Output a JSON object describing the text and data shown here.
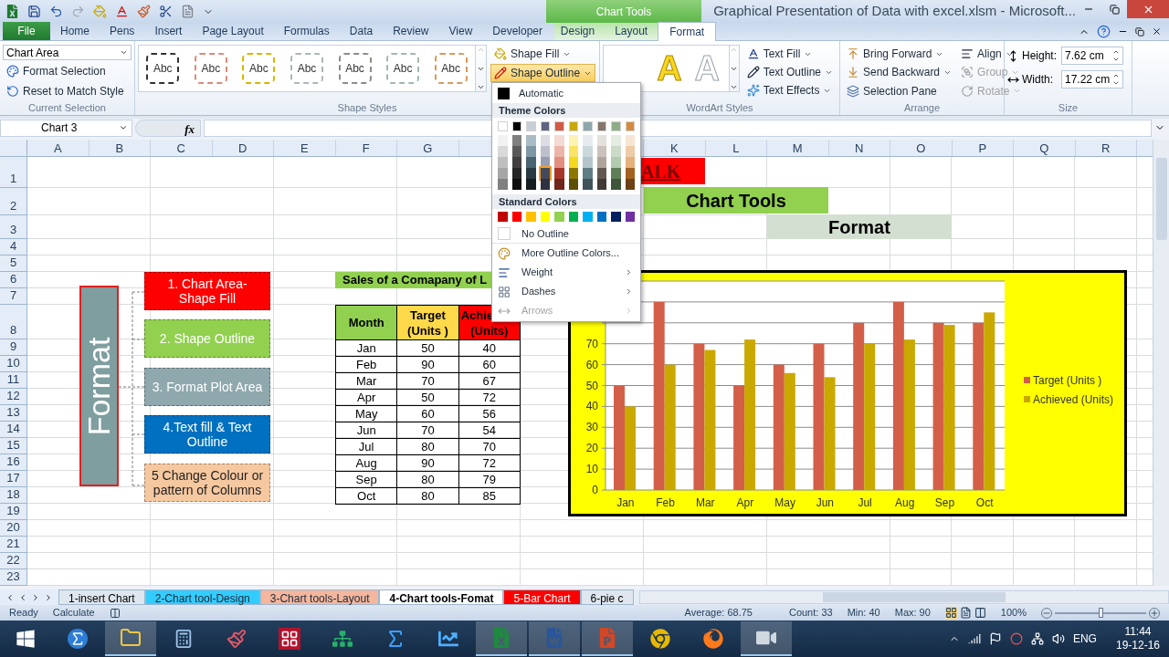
{
  "window": {
    "title": "Graphical Presentation of Data with excel.xlsm - Microsoft...",
    "context_group": "Chart Tools"
  },
  "tabs": [
    {
      "label": "File",
      "kind": "file",
      "selected": false
    },
    {
      "label": "Home",
      "kind": "tab",
      "selected": false
    },
    {
      "label": "Pens",
      "kind": "tab",
      "selected": false
    },
    {
      "label": "Insert",
      "kind": "tab",
      "selected": false
    },
    {
      "label": "Page Layout",
      "kind": "tab",
      "selected": false
    },
    {
      "label": "Formulas",
      "kind": "tab",
      "selected": false
    },
    {
      "label": "Data",
      "kind": "tab",
      "selected": false
    },
    {
      "label": "Review",
      "kind": "tab",
      "selected": false
    },
    {
      "label": "View",
      "kind": "tab",
      "selected": false
    },
    {
      "label": "Developer",
      "kind": "tab",
      "selected": false
    },
    {
      "label": "Design",
      "kind": "context",
      "selected": false
    },
    {
      "label": "Layout",
      "kind": "context",
      "selected": false
    },
    {
      "label": "Format",
      "kind": "context",
      "selected": true
    }
  ],
  "ribbon": {
    "current_selection": {
      "label": "Current Selection",
      "element": "Chart Area",
      "buttons": [
        "Format Selection",
        "Reset to Match Style"
      ]
    },
    "shape_styles": {
      "label": "Shape Styles",
      "presets": [
        {
          "text": "Abc",
          "color": "#333333"
        },
        {
          "text": "Abc",
          "color": "#d98a7a"
        },
        {
          "text": "Abc",
          "color": "#d9b400"
        },
        {
          "text": "Abc",
          "color": "#aab6bb"
        },
        {
          "text": "Abc",
          "color": "#8f8a86"
        },
        {
          "text": "Abc",
          "color": "#a3b8ab"
        },
        {
          "text": "Abc",
          "color": "#d79a5c"
        }
      ],
      "buttons": [
        {
          "label": "Shape Fill",
          "selected": false
        },
        {
          "label": "Shape Outline",
          "selected": true
        }
      ]
    },
    "wordart_styles": {
      "label": "WordArt Styles",
      "presets": [
        {
          "text": "A",
          "kind": "gold"
        },
        {
          "text": "A",
          "kind": "white"
        }
      ],
      "buttons": [
        "Text Fill",
        "Text Outline",
        "Text Effects"
      ]
    },
    "arrange": {
      "label": "Arrange",
      "buttons": [
        {
          "label": "Bring Forward",
          "dropdown": true,
          "disabled": false
        },
        {
          "label": "Send Backward",
          "dropdown": true,
          "disabled": false
        },
        {
          "label": "Selection Pane",
          "dropdown": false,
          "disabled": false
        },
        {
          "label": "Align",
          "dropdown": true,
          "disabled": false
        },
        {
          "label": "Group",
          "dropdown": true,
          "disabled": true
        },
        {
          "label": "Rotate",
          "dropdown": true,
          "disabled": true
        }
      ]
    },
    "size": {
      "label": "Size",
      "fields": [
        {
          "label": "Height:",
          "value": "7.62 cm"
        },
        {
          "label": "Width:",
          "value": "17.22 cm"
        }
      ]
    }
  },
  "formula_bar": {
    "name_box": "Chart 3",
    "fx": "fx"
  },
  "outline_menu": {
    "automatic": "Automatic",
    "theme_header": "Theme Colors",
    "theme_colors": [
      [
        {
          "color": "#ffffff",
          "selected": false
        },
        {
          "color": "#000000",
          "selected": false
        },
        {
          "color": "#c6cfd6",
          "selected": false
        },
        {
          "color": "#5d6380",
          "selected": false
        },
        {
          "color": "#d35b45",
          "selected": false
        },
        {
          "color": "#c9a90a",
          "selected": false
        },
        {
          "color": "#8da7ac",
          "selected": false
        },
        {
          "color": "#85766a",
          "selected": false
        },
        {
          "color": "#8fad87",
          "selected": false
        },
        {
          "color": "#d48b3d",
          "selected": false
        }
      ],
      [
        {
          "color": "#f2f2f2",
          "selected": false
        },
        {
          "color": "#7f7f7f",
          "selected": false
        },
        {
          "color": "#a9bcc6",
          "selected": false
        },
        {
          "color": "#dcdde3",
          "selected": false
        },
        {
          "color": "#f5d9d3",
          "selected": false
        },
        {
          "color": "#fdf2b0",
          "selected": false
        },
        {
          "color": "#e6ecee",
          "selected": false
        },
        {
          "color": "#e4e0dc",
          "selected": false
        },
        {
          "color": "#e5ede3",
          "selected": false
        },
        {
          "color": "#f6e5d3",
          "selected": false
        }
      ],
      [
        {
          "color": "#d9d9d9",
          "selected": false
        },
        {
          "color": "#595959",
          "selected": false
        },
        {
          "color": "#7d97a4",
          "selected": false
        },
        {
          "color": "#bcbfcc",
          "selected": false
        },
        {
          "color": "#ecb5aa",
          "selected": false
        },
        {
          "color": "#fae466",
          "selected": false
        },
        {
          "color": "#cbd8dc",
          "selected": false
        },
        {
          "color": "#cac2bb",
          "selected": false
        },
        {
          "color": "#cbdbc8",
          "selected": false
        },
        {
          "color": "#edcba7",
          "selected": false
        }
      ],
      [
        {
          "color": "#bfbfbf",
          "selected": false
        },
        {
          "color": "#404040",
          "selected": false
        },
        {
          "color": "#4a6471",
          "selected": false
        },
        {
          "color": "#9a9eb3",
          "selected": false
        },
        {
          "color": "#e28f80",
          "selected": false
        },
        {
          "color": "#f5d91f",
          "selected": false
        },
        {
          "color": "#b3c5ca",
          "selected": false
        },
        {
          "color": "#b0a59a",
          "selected": false
        },
        {
          "color": "#b2caad",
          "selected": false
        },
        {
          "color": "#e4b27c",
          "selected": false
        }
      ],
      [
        {
          "color": "#a6a6a6",
          "selected": false
        },
        {
          "color": "#262626",
          "selected": false
        },
        {
          "color": "#2a3a42",
          "selected": false
        },
        {
          "color": "#444a5c",
          "selected": true
        },
        {
          "color": "#a8372a",
          "selected": false
        },
        {
          "color": "#8c7600",
          "selected": false
        },
        {
          "color": "#5f7d85",
          "selected": false
        },
        {
          "color": "#625a51",
          "selected": false
        },
        {
          "color": "#5f7f58",
          "selected": false
        },
        {
          "color": "#a3621f",
          "selected": false
        }
      ],
      [
        {
          "color": "#808080",
          "selected": false
        },
        {
          "color": "#0d0d0d",
          "selected": false
        },
        {
          "color": "#151d21",
          "selected": false
        },
        {
          "color": "#2e3240",
          "selected": false
        },
        {
          "color": "#6f2519",
          "selected": false
        },
        {
          "color": "#5c4e00",
          "selected": false
        },
        {
          "color": "#3f5359",
          "selected": false
        },
        {
          "color": "#413b35",
          "selected": false
        },
        {
          "color": "#3f553b",
          "selected": false
        },
        {
          "color": "#6c4115",
          "selected": false
        }
      ]
    ],
    "standard_header": "Standard Colors",
    "standard_colors": [
      {
        "color": "#c00000",
        "selected": false
      },
      {
        "color": "#ff0000",
        "selected": false
      },
      {
        "color": "#ffc000",
        "selected": false
      },
      {
        "color": "#ffff00",
        "selected": false
      },
      {
        "color": "#92d050",
        "selected": false
      },
      {
        "color": "#00b050",
        "selected": false
      },
      {
        "color": "#00b0f0",
        "selected": false
      },
      {
        "color": "#0070c0",
        "selected": false
      },
      {
        "color": "#002060",
        "selected": false
      },
      {
        "color": "#7030a0",
        "selected": false
      }
    ],
    "no_outline": "No Outline",
    "items": [
      {
        "label": "More Outline Colors...",
        "submenu": false,
        "disabled": false
      },
      {
        "label": "Weight",
        "submenu": true,
        "disabled": false
      },
      {
        "label": "Dashes",
        "submenu": true,
        "disabled": false
      },
      {
        "label": "Arrows",
        "submenu": true,
        "disabled": true
      }
    ]
  },
  "sheet": {
    "columns_left": [
      "A",
      "B",
      "C",
      "D",
      "E",
      "F",
      "G"
    ],
    "columns_right": [
      "K",
      "L",
      "M",
      "N",
      "O",
      "P",
      "Q",
      "R"
    ],
    "rows": [
      "1",
      "2",
      "3",
      "4",
      "5",
      "6",
      "7",
      "8",
      "9",
      "10",
      "11",
      "12",
      "13",
      "14",
      "15",
      "16",
      "17",
      "18",
      "19",
      "20",
      "21",
      "22",
      "23"
    ],
    "banners": [
      {
        "text": "ALK",
        "color": "#ff0000"
      },
      {
        "text": "Chart Tools",
        "color": "#92d050"
      },
      {
        "text": "Format",
        "color": "#d3dfd0"
      }
    ],
    "format_box": {
      "text": "Format",
      "color": "#7f9ea0"
    },
    "steps": [
      {
        "lines": [
          "1. Chart Area-",
          "Shape Fill"
        ],
        "color": "#ff0000"
      },
      {
        "lines": [
          "2. Shape Outline"
        ],
        "color": "#92d050"
      },
      {
        "lines": [
          "3. Format Plot Area"
        ],
        "color": "#8fa8ad"
      },
      {
        "lines": [
          "4.Text fill & Text",
          "Outline"
        ],
        "color": "#0070c0"
      },
      {
        "lines": [
          "5  Change Colour or",
          "pattern of Columns"
        ],
        "color": "#f6c8a0"
      }
    ],
    "table": {
      "title": "Sales of a Comapany of L",
      "columns": [
        {
          "lines": [
            "Month"
          ],
          "color": "#92d050",
          "clipped": false
        },
        {
          "lines": [
            "Target",
            "(Units )"
          ],
          "color": "#ffd94a",
          "clipped": false
        },
        {
          "lines": [
            "Achie",
            "(Units)"
          ],
          "color": "#ff0000",
          "clipped": true
        }
      ],
      "rows": [
        [
          "Jan",
          "50",
          "40"
        ],
        [
          "Feb",
          "90",
          "60"
        ],
        [
          "Mar",
          "70",
          "67"
        ],
        [
          "Apr",
          "50",
          "72"
        ],
        [
          "May",
          "60",
          "56"
        ],
        [
          "Jun",
          "70",
          "54"
        ],
        [
          "Jul",
          "80",
          "70"
        ],
        [
          "Aug",
          "90",
          "72"
        ],
        [
          "Sep",
          "80",
          "79"
        ],
        [
          "Oct",
          "80",
          "85"
        ]
      ]
    },
    "chart": {
      "chart_data": {
        "type": "bar",
        "categories": [
          "Jan",
          "Feb",
          "Mar",
          "Apr",
          "May",
          "Jun",
          "Jul",
          "Aug",
          "Sep",
          "Oct"
        ],
        "series": [
          {
            "name": "Target (Units )",
            "color": "#d35f48",
            "values": [
              50,
              90,
              70,
              50,
              60,
              70,
              80,
              90,
              80,
              80
            ]
          },
          {
            "name": "Achieved (Units)",
            "color": "#c9a800",
            "values": [
              40,
              60,
              67,
              72,
              56,
              54,
              70,
              72,
              79,
              85
            ]
          }
        ],
        "ylim": [
          0,
          100
        ],
        "yticks": [
          {
            "value": 0,
            "label": "0"
          },
          {
            "value": 10,
            "label": "10"
          },
          {
            "value": 20,
            "label": "20"
          },
          {
            "value": 30,
            "label": "30"
          },
          {
            "value": 40,
            "label": "40"
          },
          {
            "value": 50,
            "label": "50"
          },
          {
            "value": 60,
            "label": "60"
          },
          {
            "value": 70,
            "label": "70"
          }
        ],
        "grid": true,
        "legend": true
      }
    }
  },
  "sheet_tabs": [
    {
      "label": "1-insert  Chart",
      "selected": false
    },
    {
      "label": "2-Chart tool-Design",
      "color": "#33ccff",
      "selected": false
    },
    {
      "label": "3-Chart tools-Layout",
      "color": "#f4b69c",
      "selected": false
    },
    {
      "label": "4-Chart tools-Fomat",
      "selected": true
    },
    {
      "label": "5-Bar Chart",
      "color": "#ff0000",
      "selected": false
    },
    {
      "label": "6-pie c",
      "selected": false
    }
  ],
  "status_bar": {
    "mode": "Ready",
    "calculate": "Calculate",
    "average": "Average: 68.75",
    "count": "Count: 33",
    "min": "Min: 40",
    "max": "Max: 90",
    "zoom": "100%",
    "zoom_slider": {
      "level": 0.5
    }
  },
  "taskbar": {
    "apps": [
      {
        "running": false
      },
      {
        "running": true
      },
      {
        "running": false
      },
      {
        "running": false
      },
      {
        "running": false
      },
      {
        "running": false
      },
      {
        "running": false
      },
      {
        "running": false
      },
      {
        "running": true
      },
      {
        "running": true
      },
      {
        "running": true
      },
      {
        "running": false
      },
      {
        "running": false
      },
      {
        "running": true
      }
    ],
    "language": "ENG",
    "time": "11:44",
    "date": "19-12-16"
  }
}
